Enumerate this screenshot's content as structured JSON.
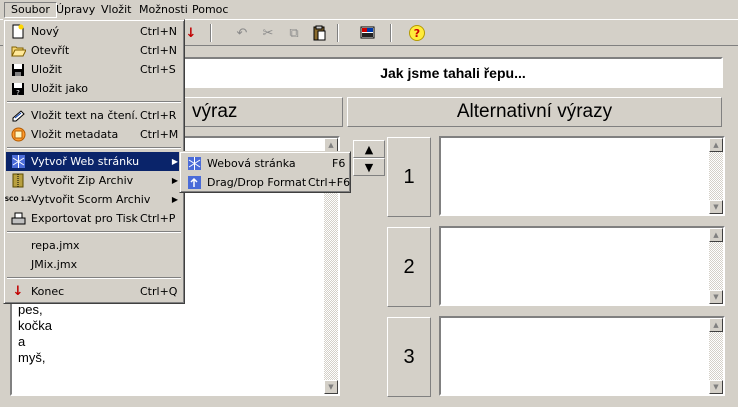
{
  "menubar": {
    "items": [
      "Soubor",
      "Úpravy",
      "Vložit",
      "Možnosti",
      "Pomoc"
    ]
  },
  "toolbar": {
    "buttons": [
      {
        "icon": "down-arrow-icon",
        "glyph": "↓",
        "color": "#c00000"
      },
      {
        "icon": "undo-icon",
        "glyph": "↶"
      },
      {
        "icon": "cut-icon",
        "glyph": "✂"
      },
      {
        "icon": "copy-icon",
        "glyph": "⧉"
      },
      {
        "icon": "paste-icon",
        "glyph": "📋"
      },
      {
        "icon": "web-icon",
        "glyph": "▦"
      },
      {
        "icon": "help-icon",
        "glyph": "?"
      }
    ]
  },
  "title": "Jak jsme tahali řepu...",
  "headers": {
    "left": "výraz",
    "right": "Alternativní výrazy"
  },
  "left_list_visible": [
    "pes,",
    "kočka",
    "a",
    "myš,"
  ],
  "alternatives": [
    "1",
    "2",
    "3"
  ],
  "file_menu": {
    "items": [
      {
        "label": "Nový",
        "shortcut": "Ctrl+N",
        "icon": "new-file-icon"
      },
      {
        "label": "Otevřít",
        "shortcut": "Ctrl+N",
        "icon": "open-folder-icon"
      },
      {
        "label": "Uložit",
        "shortcut": "Ctrl+S",
        "icon": "save-disk-icon"
      },
      {
        "label": "Uložit jako",
        "shortcut": "",
        "icon": "save-as-icon"
      },
      {
        "sep": true
      },
      {
        "label": "Vložit text na čtení.",
        "shortcut": "Ctrl+R",
        "icon": "insert-text-icon"
      },
      {
        "label": "Vložit metadata",
        "shortcut": "Ctrl+M",
        "icon": "metadata-icon"
      },
      {
        "sep": true
      },
      {
        "label": "Vytvoř Web stránku",
        "shortcut": "",
        "icon": "web-page-icon",
        "submenu": true,
        "highlighted": true
      },
      {
        "label": "Vytvořit Zip Archiv",
        "shortcut": "",
        "icon": "zip-icon",
        "submenu": true
      },
      {
        "label": "Vytvořit Scorm Archiv",
        "shortcut": "",
        "icon": "scorm-icon",
        "submenu": true
      },
      {
        "label": "Exportovat pro Tisk",
        "shortcut": "Ctrl+P",
        "icon": "print-icon"
      },
      {
        "sep": true
      },
      {
        "label": "repa.jmx",
        "shortcut": "",
        "icon": ""
      },
      {
        "label": "JMix.jmx",
        "shortcut": "",
        "icon": ""
      },
      {
        "sep": true
      },
      {
        "label": "Konec",
        "shortcut": "Ctrl+Q",
        "icon": "exit-arrow-icon"
      }
    ]
  },
  "web_submenu": {
    "items": [
      {
        "label": "Webová stránka",
        "shortcut": "F6",
        "icon": "web-page-icon"
      },
      {
        "label": "Drag/Drop Format",
        "shortcut": "Ctrl+F6",
        "icon": "drag-drop-icon"
      }
    ]
  },
  "scorm_label": "SCO 1.2"
}
